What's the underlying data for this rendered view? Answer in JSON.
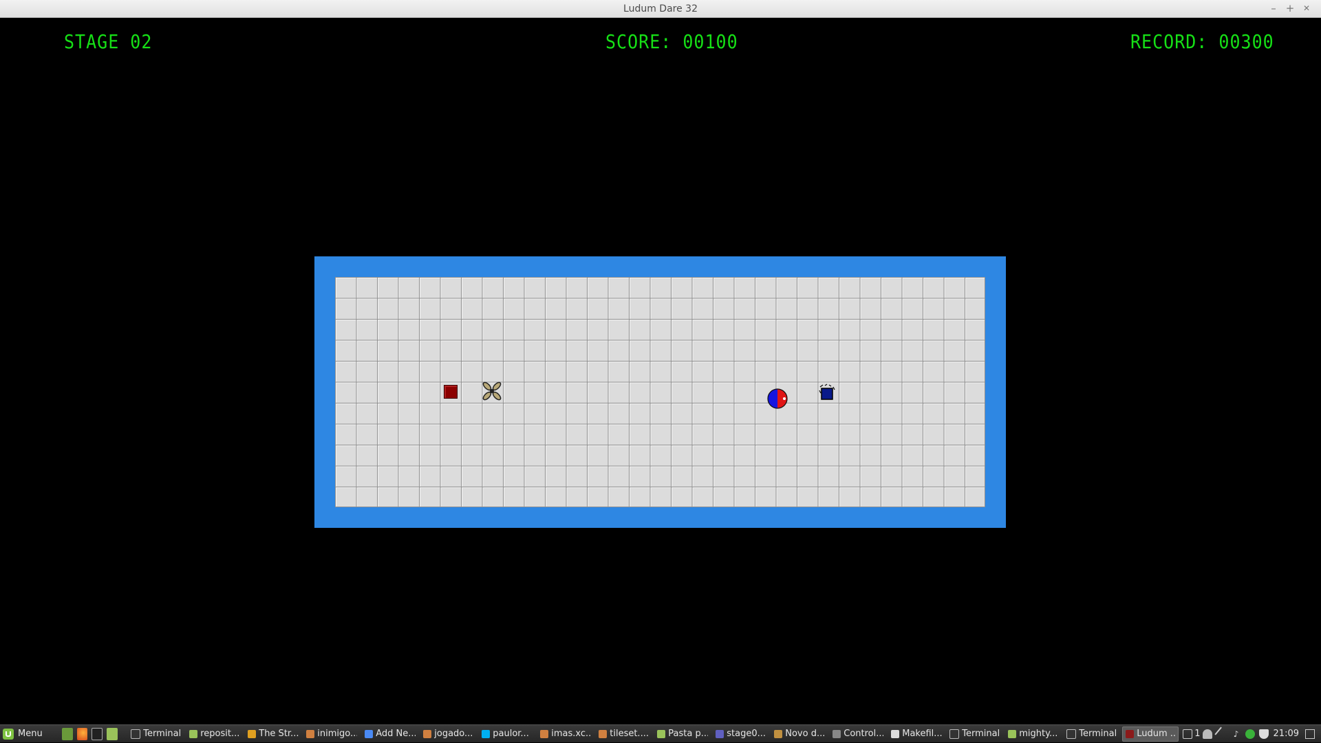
{
  "window": {
    "title": "Ludum Dare 32",
    "minimize": "–",
    "maximize": "+",
    "close": "✕"
  },
  "hud": {
    "stage": "STAGE 02",
    "score": "SCORE: 00100",
    "record": "RECORD: 00300",
    "color": "#16e016"
  },
  "field": {
    "border_color": "#2e87e3",
    "columns": 31,
    "rows": 11
  },
  "entities": [
    {
      "name": "enemy-red-block",
      "icon": "red-square"
    },
    {
      "name": "enemy-spinner",
      "icon": "cross-propeller"
    },
    {
      "name": "player-ball",
      "icon": "red-blue-ball"
    },
    {
      "name": "enemy-blue-block",
      "icon": "blue-square"
    }
  ],
  "taskbar": {
    "menu_label": "Menu",
    "tasks": [
      {
        "label": "Terminal",
        "icon": "terminal-icon"
      },
      {
        "label": "reposit...",
        "icon": "folder-icon"
      },
      {
        "label": "The Str...",
        "icon": "book-icon"
      },
      {
        "label": "inimigo...",
        "icon": "image-icon"
      },
      {
        "label": "Add Ne...",
        "icon": "chrome-icon"
      },
      {
        "label": "jogado...",
        "icon": "image-icon"
      },
      {
        "label": "paulor...",
        "icon": "skype-icon"
      },
      {
        "label": "imas.xc...",
        "icon": "image-icon"
      },
      {
        "label": "tileset....",
        "icon": "image-icon"
      },
      {
        "label": "Pasta p...",
        "icon": "folder-icon"
      },
      {
        "label": "stage0...",
        "icon": "text-icon"
      },
      {
        "label": "Novo d...",
        "icon": "document-icon"
      },
      {
        "label": "Control...",
        "icon": "settings-icon"
      },
      {
        "label": "Makefil...",
        "icon": "editor-icon"
      },
      {
        "label": "Terminal",
        "icon": "terminal-icon"
      },
      {
        "label": "mighty...",
        "icon": "folder-icon"
      },
      {
        "label": "Terminal",
        "icon": "terminal-icon"
      },
      {
        "label": "Ludum ...",
        "icon": "game-icon",
        "active": true
      }
    ],
    "tray": {
      "notifications": "1",
      "clock": "21:09"
    }
  }
}
